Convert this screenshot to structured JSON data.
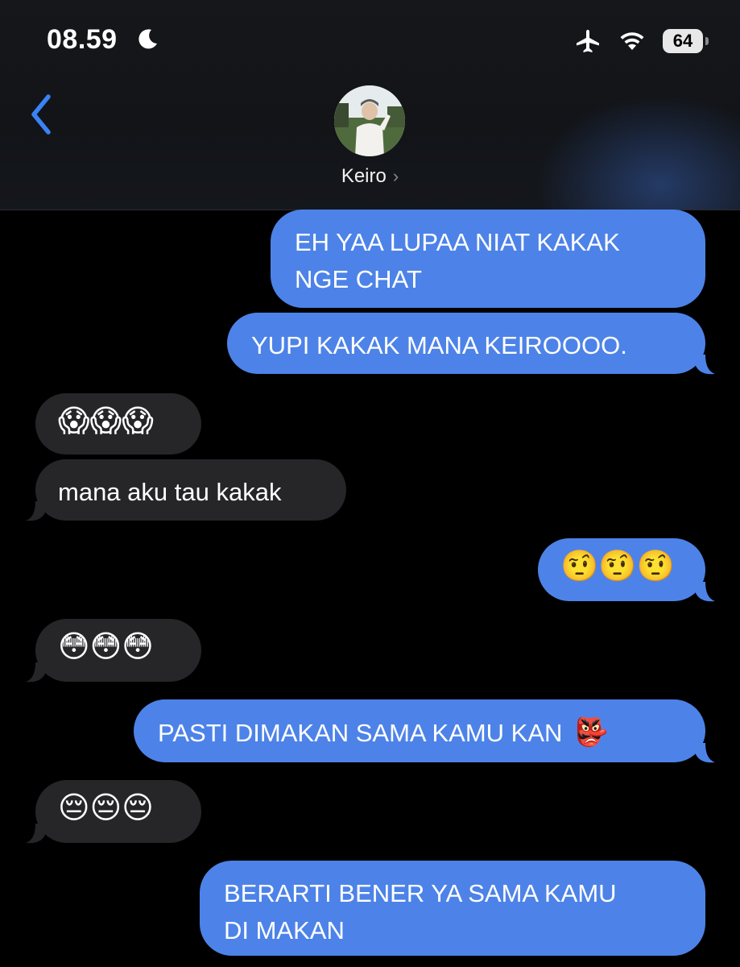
{
  "status_bar": {
    "time": "08.59",
    "battery": "64"
  },
  "header": {
    "contact_name": "Keiro",
    "chevron": "›"
  },
  "messages": [
    {
      "side": "out",
      "text_line1": "EH YAA LUPAA NIAT KAKAK",
      "text_line2": "NGE CHAT"
    },
    {
      "side": "out",
      "text": "YUPI KAKAK MANA KEIROOOO."
    },
    {
      "side": "in",
      "emoji": "😱😱😱"
    },
    {
      "side": "in",
      "text": "mana aku tau kakak"
    },
    {
      "side": "out",
      "emoji": "🤨🤨🤨"
    },
    {
      "side": "in",
      "emoji": "😳😳😳"
    },
    {
      "side": "out",
      "text": "PASTI DIMAKAN SAMA KAMU KAN",
      "emoji": "👺"
    },
    {
      "side": "in",
      "emoji": "😔😔😔"
    },
    {
      "side": "out",
      "text_line1": "BERARTI BENER YA SAMA KAMU",
      "text_line2": "DI MAKAN"
    }
  ],
  "colors": {
    "outgoing_bubble": "#4d83e8",
    "incoming_bubble": "#262629",
    "accent": "#3a82f6"
  }
}
